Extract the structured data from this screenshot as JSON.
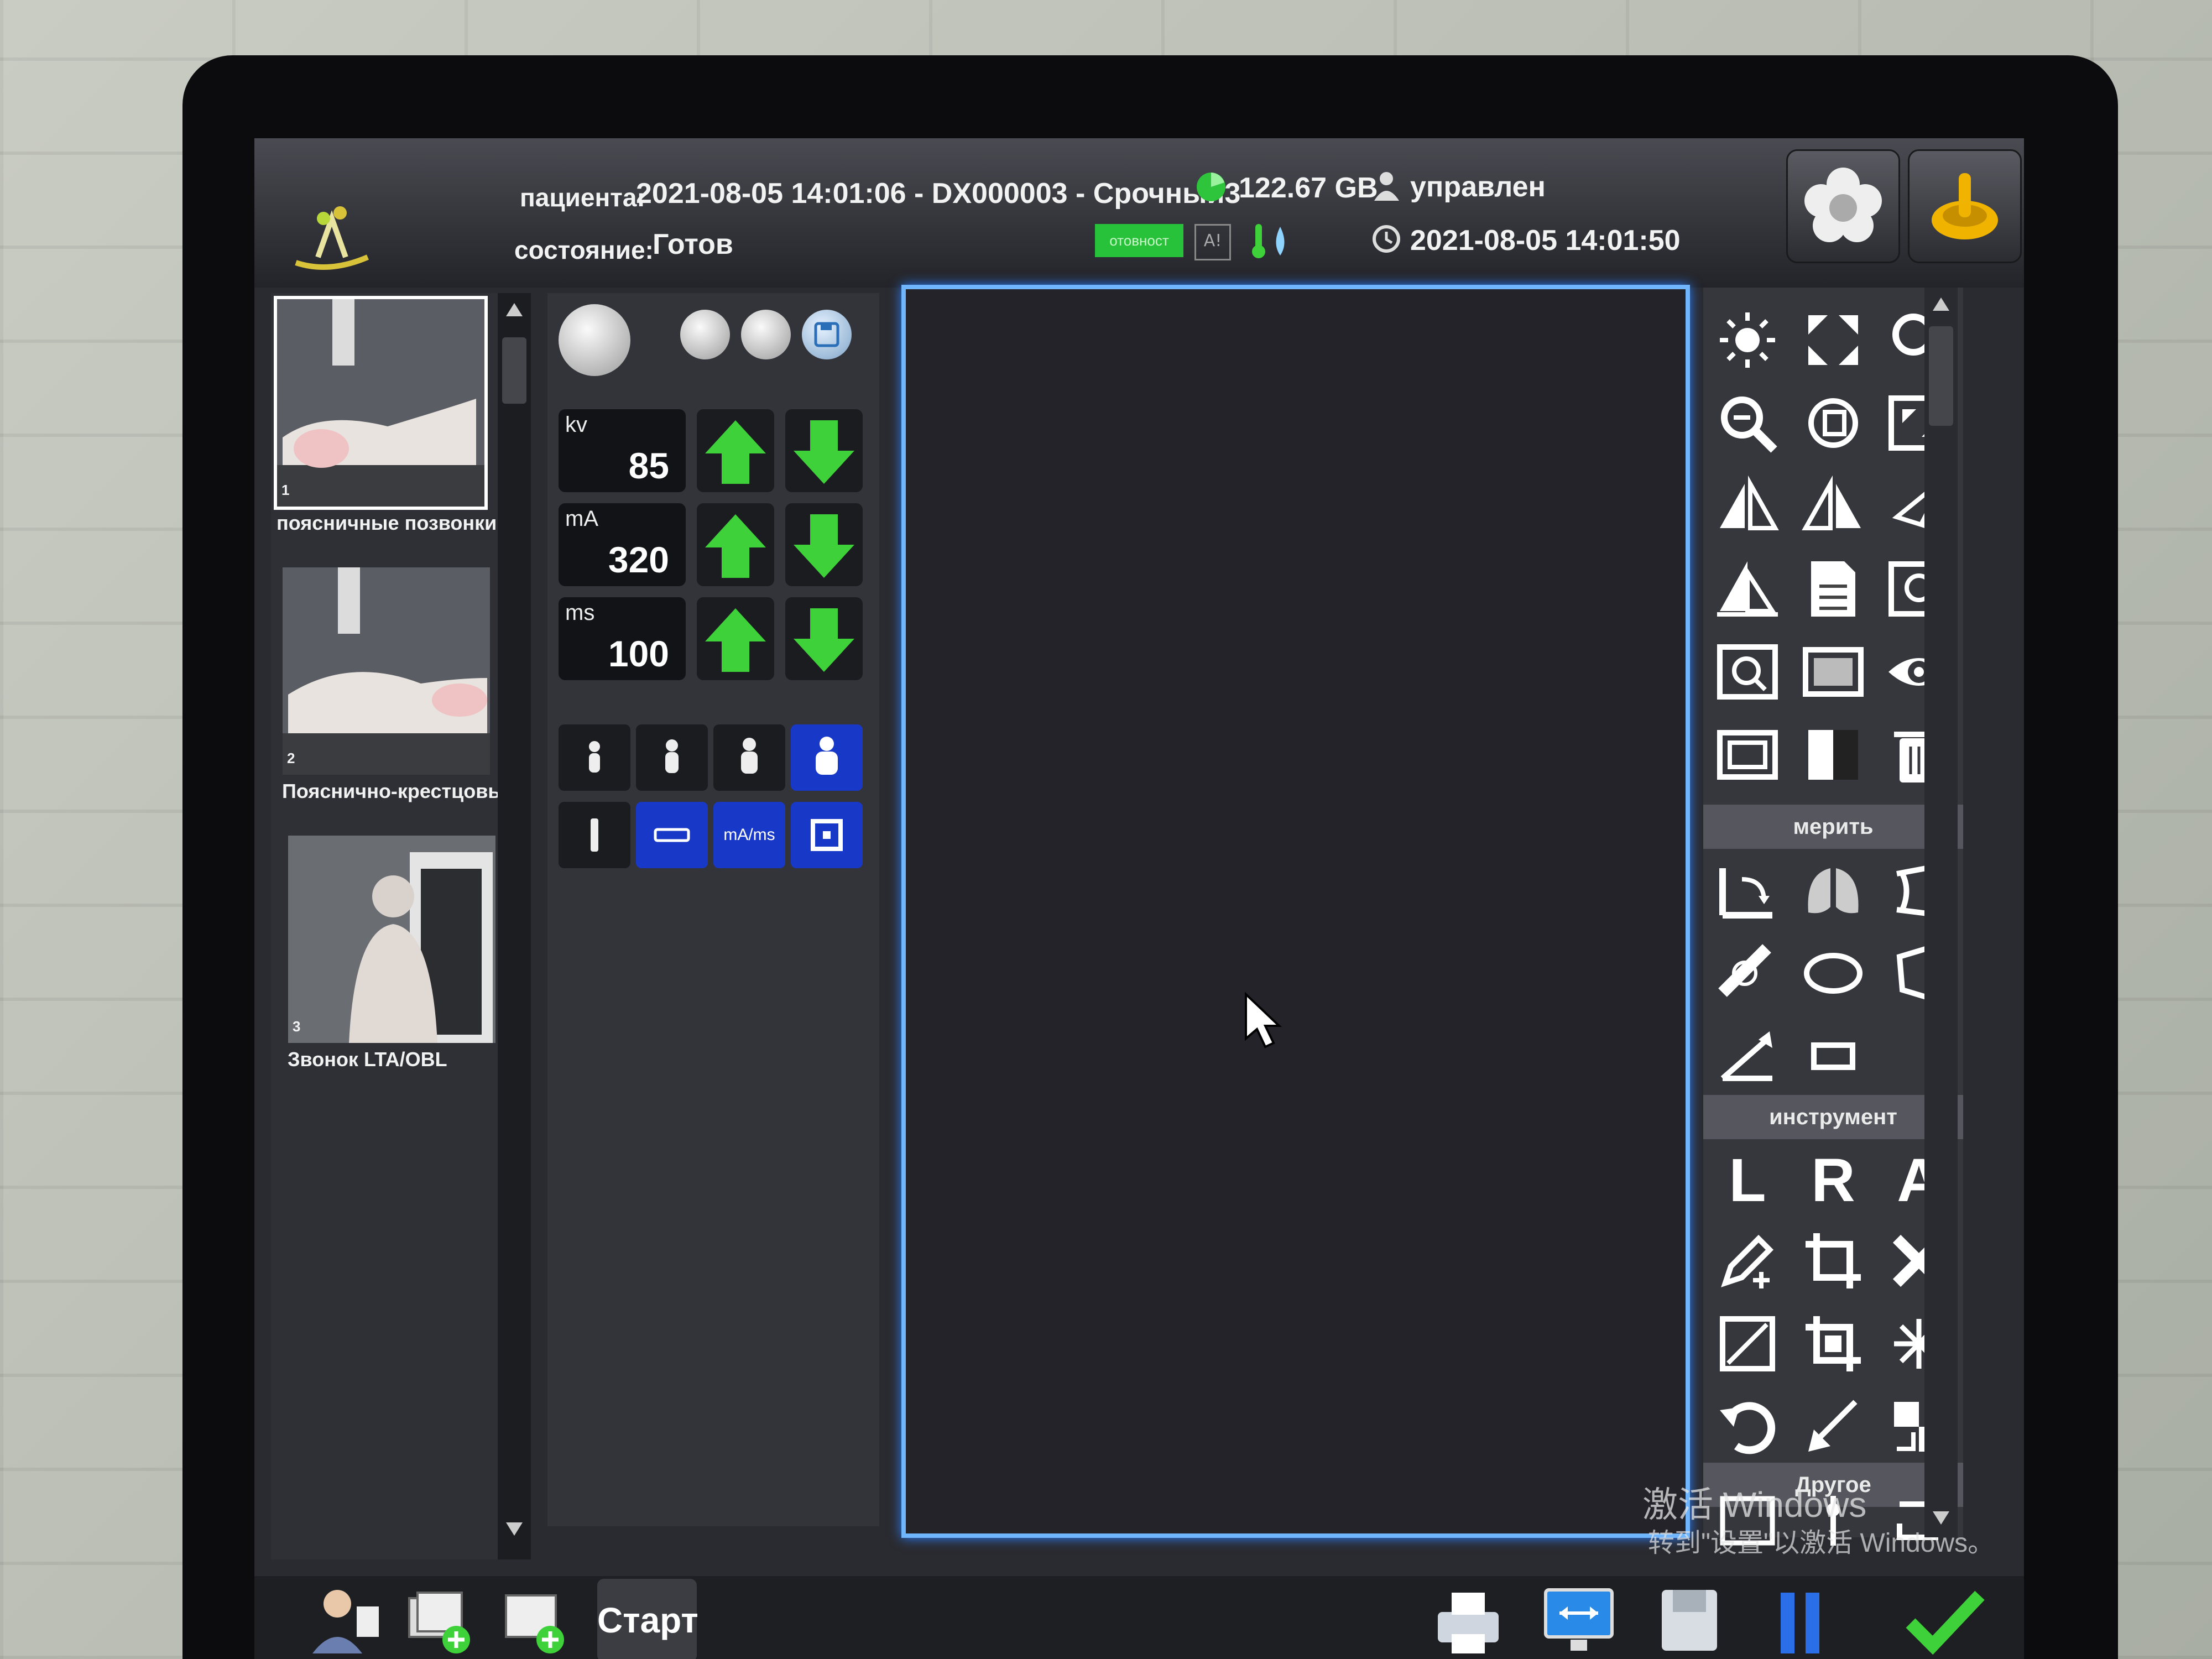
{
  "header": {
    "patient_label": "пациента:",
    "patient_value": "2021-08-05 14:01:06 - DX000003 - Срочный3",
    "status_label": "состояние:",
    "status_value": "Готов",
    "disk_free": "122.67 GB",
    "user_label": "управлен",
    "datetime": "2021-08-05 14:01:50",
    "green_indicator": "отовност",
    "ai_indicator": "A!"
  },
  "thumbnails": [
    {
      "index": "1",
      "caption": "поясничные позвонки"
    },
    {
      "index": "2",
      "caption": "Пояснично-крестцовы"
    },
    {
      "index": "3",
      "caption": "Звонок LTA/OBL"
    }
  ],
  "exposure": {
    "kv": {
      "label": "kv",
      "value": "85"
    },
    "ma": {
      "label": "mA",
      "value": "320"
    },
    "ms": {
      "label": "ms",
      "value": "100"
    },
    "mode_buttons": [
      "",
      "mA/ms",
      ""
    ]
  },
  "tools": {
    "measure_label": "мерить",
    "instrument_label": "инструмент",
    "other_label": "Другое",
    "letters": [
      "L",
      "R",
      "A"
    ]
  },
  "bottom": {
    "start_label": "Старт"
  },
  "watermark": {
    "line1": "激活 Windows",
    "line2": "转到\"设置\"以激活 Windows。"
  },
  "colors": {
    "accent_blue": "#6fb6ff",
    "arrow_green": "#3ed13a",
    "power_yellow": "#f0b400"
  }
}
